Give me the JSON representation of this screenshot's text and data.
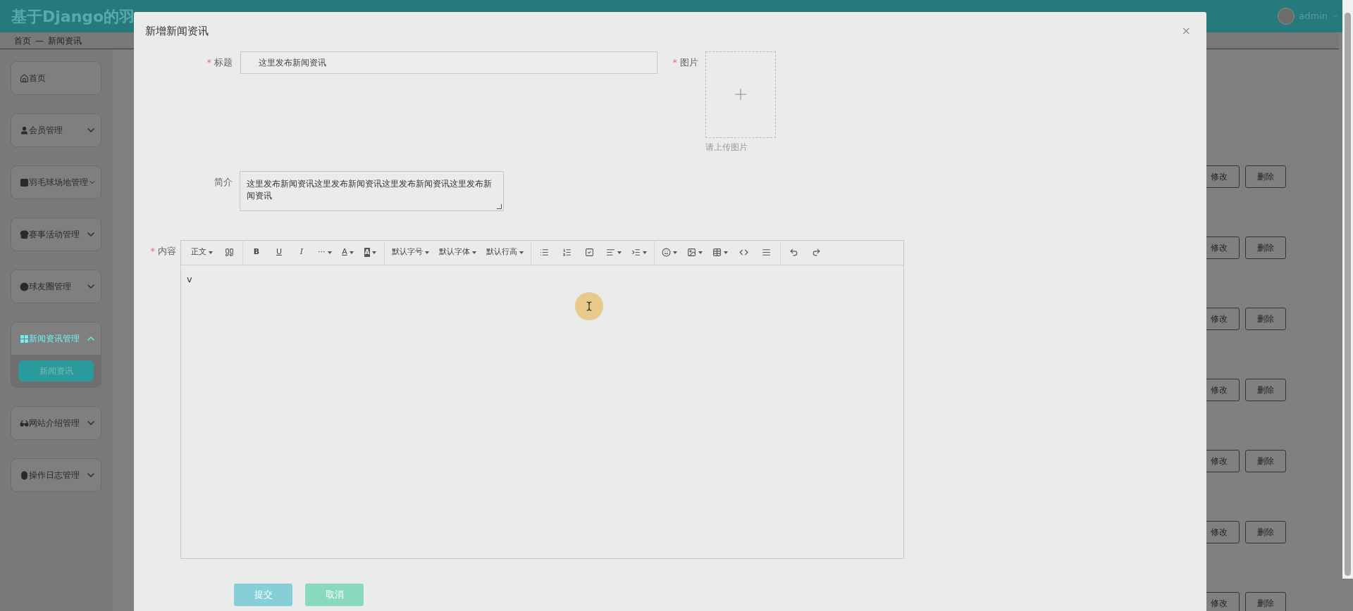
{
  "header": {
    "title": "基于Django的羽",
    "user": "admin"
  },
  "breadcrumb": [
    "首页",
    "—",
    "新闻资讯"
  ],
  "sidebar": {
    "items": [
      {
        "label": "首页",
        "has_children": false,
        "expanded": false
      },
      {
        "label": "会员管理",
        "has_children": true,
        "expanded": false
      },
      {
        "label": "羽毛球场地管理",
        "has_children": true,
        "expanded": false
      },
      {
        "label": "赛事活动管理",
        "has_children": true,
        "expanded": false
      },
      {
        "label": "球友圈管理",
        "has_children": true,
        "expanded": false
      },
      {
        "label": "新闻资讯管理",
        "has_children": true,
        "expanded": true,
        "children": [
          {
            "label": "新闻资讯",
            "selected": true
          }
        ]
      },
      {
        "label": "网站介绍管理",
        "has_children": true,
        "expanded": false
      },
      {
        "label": "操作日志管理",
        "has_children": true,
        "expanded": false
      }
    ]
  },
  "table": {
    "rows": [
      {
        "edit": "修改",
        "delete": "删除"
      },
      {
        "edit": "修改",
        "delete": "删除"
      },
      {
        "edit": "修改",
        "delete": "删除"
      },
      {
        "edit": "修改",
        "delete": "删除"
      },
      {
        "edit": "修改",
        "delete": "删除"
      },
      {
        "edit": "修改",
        "delete": "删除"
      },
      {
        "edit": "修改",
        "delete": "删除"
      }
    ]
  },
  "dialog": {
    "title": "新增新闻资讯",
    "close": "×",
    "fields": {
      "title": {
        "required_mark": "*",
        "label": "标题",
        "value": "这里发布新闻资讯"
      },
      "image": {
        "required_mark": "*",
        "label": "图片",
        "hint": "请上传图片"
      },
      "summary": {
        "label": "简介",
        "value": "这里发布新闻资讯这里发布新闻资讯这里发布新闻资讯这里发布新闻资讯"
      },
      "content": {
        "required_mark": "*",
        "label": "内容",
        "value": "v"
      }
    },
    "toolbar": [
      [
        {
          "kind": "text",
          "label": "正文",
          "dropdown": true
        },
        {
          "kind": "icon",
          "dropdown": false
        }
      ],
      [
        {
          "kind": "bold",
          "label": "B",
          "dropdown": false
        },
        {
          "kind": "underline",
          "label": "U",
          "dropdown": false
        },
        {
          "kind": "italic",
          "label": "I",
          "dropdown": false
        },
        {
          "kind": "text",
          "label": "···",
          "dropdown": true
        },
        {
          "kind": "underline",
          "label": "A",
          "dropdown": true
        },
        {
          "kind": "highlight",
          "label": "A",
          "dropdown": true
        }
      ],
      [
        {
          "kind": "text",
          "label": "默认字号",
          "dropdown": true
        },
        {
          "kind": "text",
          "label": "默认字体",
          "dropdown": true
        },
        {
          "kind": "text",
          "label": "默认行高",
          "dropdown": true
        }
      ],
      [
        {
          "kind": "icon",
          "dropdown": false
        },
        {
          "kind": "icon",
          "dropdown": false
        },
        {
          "kind": "icon",
          "dropdown": false
        },
        {
          "kind": "icon",
          "dropdown": true
        },
        {
          "kind": "icon",
          "dropdown": true
        }
      ],
      [
        {
          "kind": "icon",
          "dropdown": true
        },
        {
          "kind": "icon",
          "dropdown": true
        },
        {
          "kind": "icon",
          "dropdown": true
        },
        {
          "kind": "icon",
          "dropdown": false
        },
        {
          "kind": "icon",
          "dropdown": false
        }
      ],
      [
        {
          "kind": "icon",
          "dropdown": false
        },
        {
          "kind": "icon",
          "dropdown": false
        }
      ]
    ],
    "buttons": [
      {
        "label": "提交",
        "color": "#86cfd9"
      },
      {
        "label": "取消",
        "color": "#88d9bd"
      }
    ]
  }
}
